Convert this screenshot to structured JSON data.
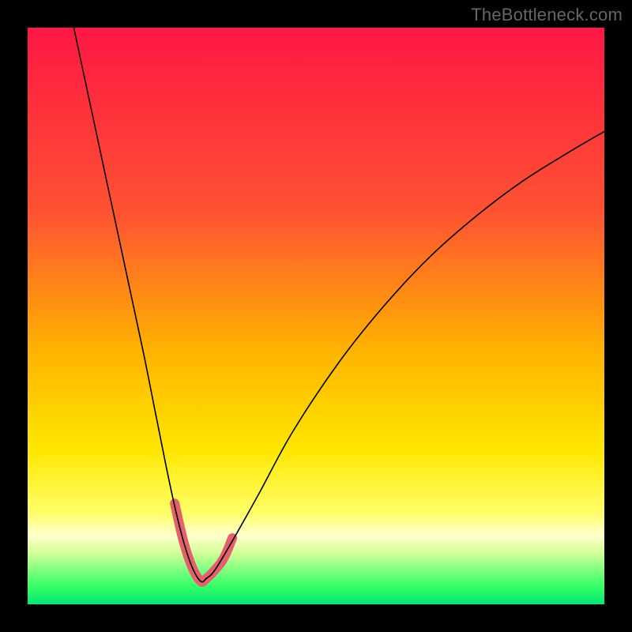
{
  "watermark": "TheBottleneck.com",
  "gradient_stops": [
    {
      "offset": 0,
      "color": "#ff1744"
    },
    {
      "offset": 32,
      "color": "#ff5232"
    },
    {
      "offset": 56,
      "color": "#ffb300"
    },
    {
      "offset": 73,
      "color": "#ffe600"
    },
    {
      "offset": 84,
      "color": "#ffff66"
    },
    {
      "offset": 88,
      "color": "#ffffcc"
    },
    {
      "offset": 91,
      "color": "#d4ff99"
    },
    {
      "offset": 94,
      "color": "#80ff80"
    },
    {
      "offset": 97,
      "color": "#33ff66"
    },
    {
      "offset": 100,
      "color": "#00e676"
    }
  ],
  "chart_data": {
    "type": "line",
    "title": "",
    "xlabel": "",
    "ylabel": "",
    "xlim": [
      0,
      100
    ],
    "ylim": [
      0,
      100
    ],
    "series": [
      {
        "name": "bottleneck-curve",
        "color": "#000000",
        "stroke_width": 1.6,
        "x": [
          8,
          11,
          14,
          17,
          20,
          22,
          24,
          25.5,
          27,
          28.5,
          30,
          31,
          32.5,
          35.5,
          40,
          46,
          54,
          62,
          70,
          78,
          86,
          94,
          100
        ],
        "y": [
          100,
          86,
          72,
          58,
          44,
          34,
          24,
          17,
          11,
          6.5,
          4,
          4.5,
          6,
          11,
          19,
          30,
          42,
          52,
          60.5,
          67.5,
          73.5,
          78.5,
          82
        ]
      },
      {
        "name": "tolerance-band",
        "color": "#e4606d",
        "stroke_width": 12,
        "linecap": "round",
        "x": [
          25.5,
          27,
          28.5,
          30,
          31,
          32.5,
          34,
          35.5
        ],
        "y": [
          17.5,
          11,
          6.5,
          4,
          4.5,
          6,
          8,
          11.5
        ]
      }
    ],
    "annotations": [
      {
        "text": "TheBottleneck.com",
        "position": "top-right"
      }
    ]
  }
}
